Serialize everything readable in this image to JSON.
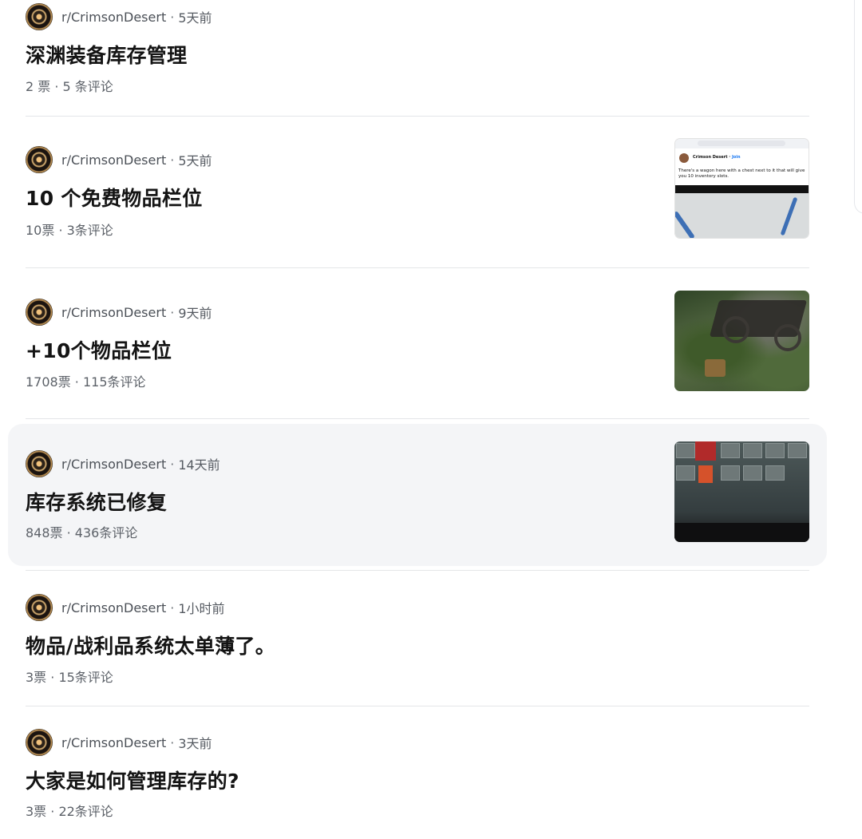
{
  "posts": [
    {
      "subreddit": "r/CrimsonDesert",
      "separator": "·",
      "time": "5天前",
      "title": "深渊装备库存管理",
      "stats": "2 票 · 5 条评论"
    },
    {
      "subreddit": "r/CrimsonDesert",
      "separator": "·",
      "time": "5天前",
      "title": "10 个免费物品栏位",
      "stats": "10票 · 3条评论"
    },
    {
      "subreddit": "r/CrimsonDesert",
      "separator": "·",
      "time": "9天前",
      "title": "+10个物品栏位",
      "stats": "1708票 · 115条评论"
    },
    {
      "subreddit": "r/CrimsonDesert",
      "separator": "·",
      "time": "14天前",
      "title": "库存系统已修复",
      "stats": "848票 · 436条评论"
    },
    {
      "subreddit": "r/CrimsonDesert",
      "separator": "·",
      "time": "1小时前",
      "title": "物品/战利品系统太单薄了。",
      "stats": "3票 · 15条评论"
    },
    {
      "subreddit": "r/CrimsonDesert",
      "separator": "·",
      "time": "3天前",
      "title": "大家是如何管理库存的?",
      "stats": "3票 · 22条评论"
    }
  ],
  "thumbnails": {
    "fb_comment": {
      "page_name": "Crimson Desert",
      "join": "Join",
      "comment": "There's a wagon here with a chest next to it that will give you 10 inventory slots."
    }
  },
  "colors": {
    "hover_bg": "#f4f5f7",
    "divider": "#e4e6e8",
    "meta_text": "#555a61",
    "title_text": "#141414"
  }
}
